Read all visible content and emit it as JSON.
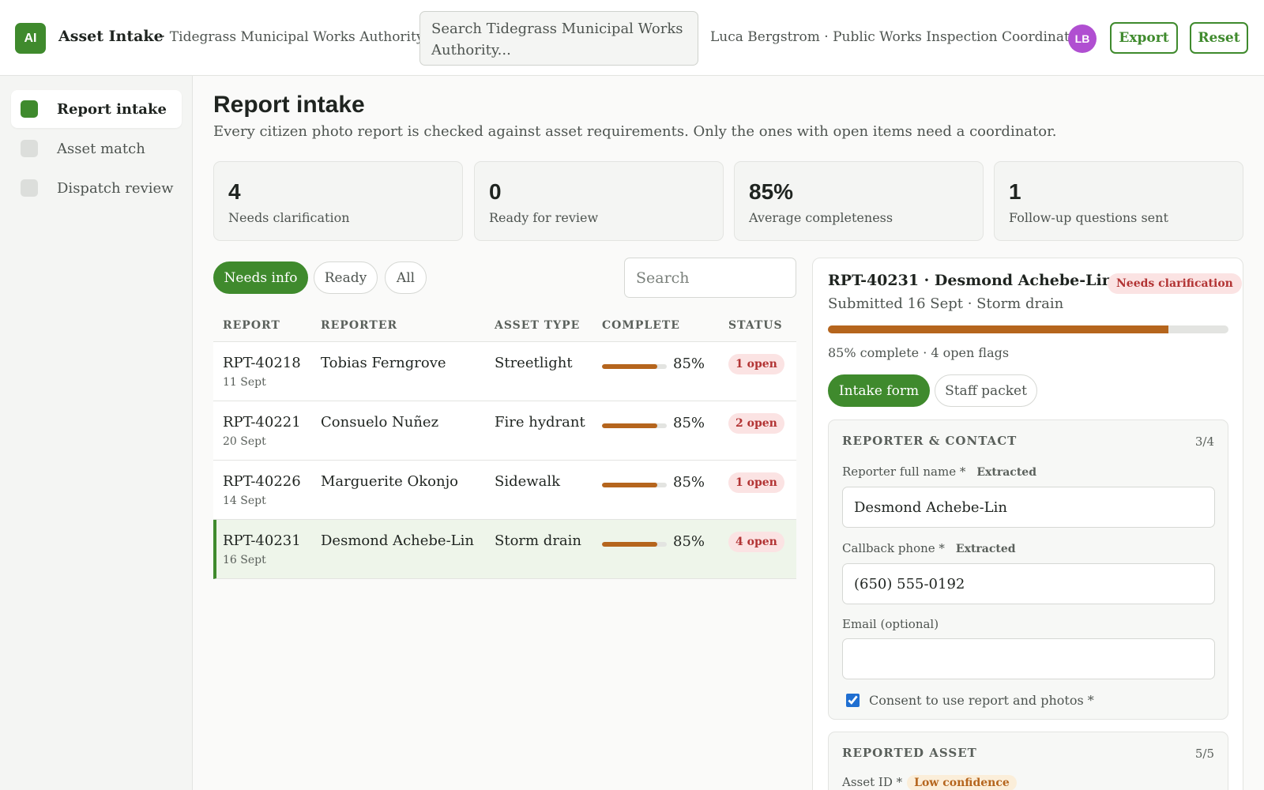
{
  "header": {
    "logo_text": "AI",
    "app_title": "Asset Intake",
    "org": "· Tidegrass Municipal Works Authority",
    "search_placeholder": "Search Tidegrass Municipal Works Authority...",
    "user": "Luca Bergstrom · Public Works Inspection Coordinator",
    "avatar_initials": "LB",
    "export_label": "Export",
    "reset_label": "Reset"
  },
  "sidebar": {
    "items": [
      {
        "label": "Report intake",
        "active": true
      },
      {
        "label": "Asset match",
        "active": false
      },
      {
        "label": "Dispatch review",
        "active": false
      }
    ]
  },
  "main": {
    "title": "Report intake",
    "subtitle": "Every citizen photo report is checked against asset requirements. Only the ones with open items need a coordinator.",
    "stats": [
      {
        "value": "4",
        "label": "Needs clarification"
      },
      {
        "value": "0",
        "label": "Ready for review"
      },
      {
        "value": "85%",
        "label": "Average completeness"
      },
      {
        "value": "1",
        "label": "Follow-up questions sent"
      }
    ],
    "filters": [
      {
        "label": "Needs info",
        "active": true
      },
      {
        "label": "Ready",
        "active": false
      },
      {
        "label": "All",
        "active": false
      }
    ],
    "search_placeholder": "Search",
    "columns": [
      "REPORT",
      "REPORTER",
      "ASSET TYPE",
      "COMPLETE",
      "STATUS"
    ],
    "rows": [
      {
        "id": "RPT-40218",
        "date": "11 Sept",
        "reporter": "Tobias Ferngrove",
        "asset_type": "Streetlight",
        "complete": 85,
        "complete_label": "85%",
        "status": "1 open",
        "selected": false
      },
      {
        "id": "RPT-40221",
        "date": "20 Sept",
        "reporter": "Consuelo Nuñez",
        "asset_type": "Fire hydrant",
        "complete": 85,
        "complete_label": "85%",
        "status": "2 open",
        "selected": false
      },
      {
        "id": "RPT-40226",
        "date": "14 Sept",
        "reporter": "Marguerite Okonjo",
        "asset_type": "Sidewalk",
        "complete": 85,
        "complete_label": "85%",
        "status": "1 open",
        "selected": false
      },
      {
        "id": "RPT-40231",
        "date": "16 Sept",
        "reporter": "Desmond Achebe-Lin",
        "asset_type": "Storm drain",
        "complete": 85,
        "complete_label": "85%",
        "status": "4 open",
        "selected": true
      }
    ]
  },
  "detail": {
    "title": "RPT-40231 · Desmond Achebe-Lin",
    "badge": "Needs clarification",
    "subtitle": "Submitted 16 Sept · Storm drain",
    "progress": 85,
    "progress_text": "85% complete · 4 open flags",
    "tabs": [
      {
        "label": "Intake form",
        "active": true
      },
      {
        "label": "Staff packet",
        "active": false
      }
    ],
    "sections": [
      {
        "title": "REPORTER & CONTACT",
        "count": "3/4",
        "fields": [
          {
            "label": "Reporter full name *",
            "tag": "Extracted",
            "value": ""
          },
          {
            "label": "Callback phone *",
            "tag": "Extracted",
            "value": ""
          },
          {
            "label": "Email (optional)",
            "tag": "",
            "value": ""
          }
        ],
        "name_value": "Desmond Achebe-Lin",
        "phone_value": "(650) 555-0192",
        "consent_label": "Consent to use report and photos *",
        "consent_checked": true
      },
      {
        "title": "REPORTED ASSET",
        "count": "5/5",
        "asset_id_label": "Asset ID *",
        "asset_id_tag": "Low confidence"
      }
    ]
  },
  "colors": {
    "accent": "#3f8a2d",
    "progress": "#b5651d",
    "status_bg": "#fbe3e3",
    "status_text": "#b23434",
    "avatar": "#b04fd1"
  }
}
